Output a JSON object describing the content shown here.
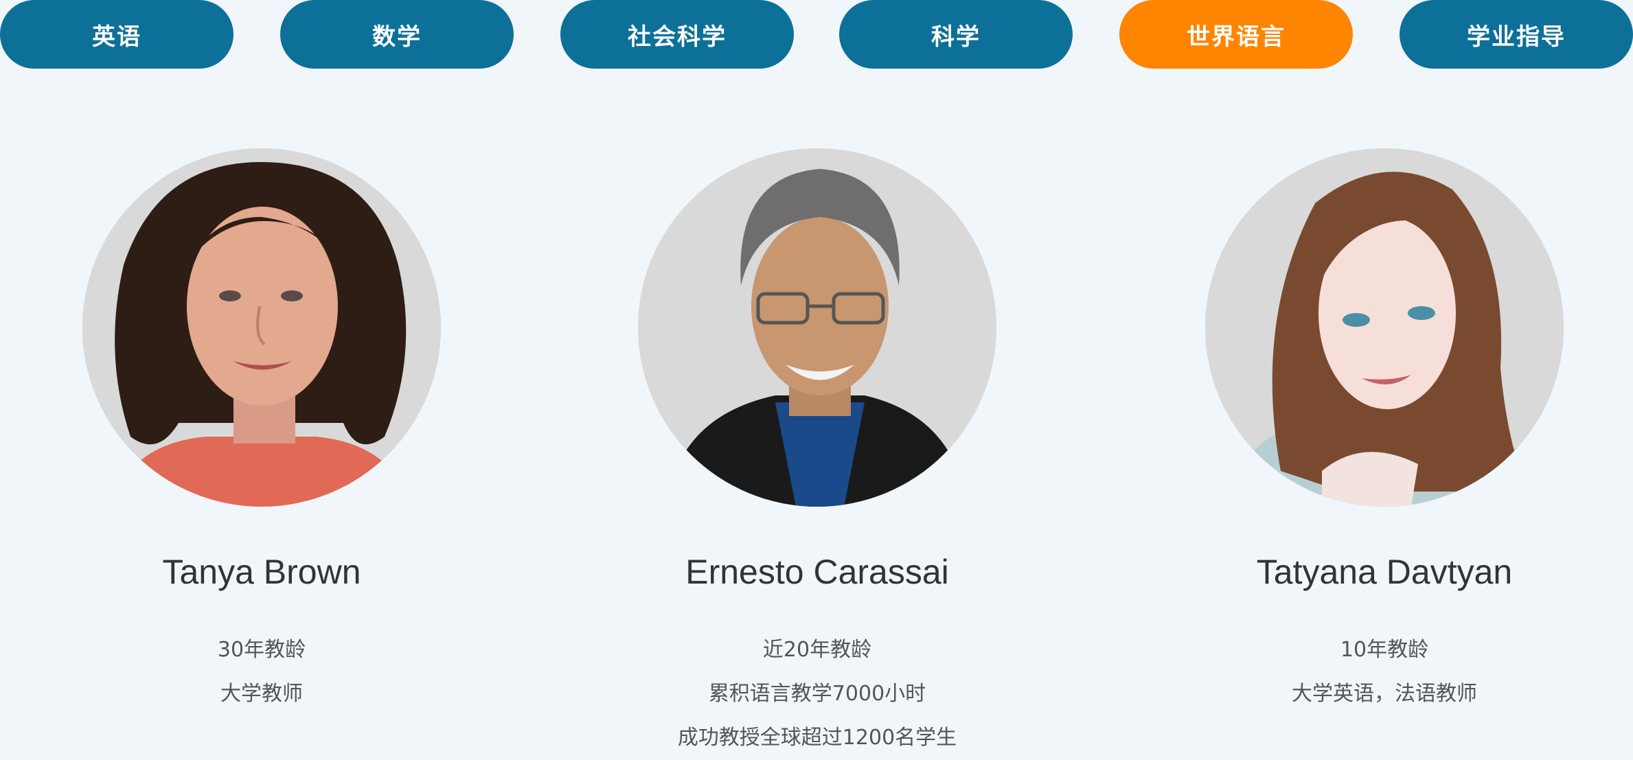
{
  "tabs": [
    {
      "label": "英语",
      "active": false
    },
    {
      "label": "数学",
      "active": false
    },
    {
      "label": "社会科学",
      "active": false
    },
    {
      "label": "科学",
      "active": false
    },
    {
      "label": "世界语言",
      "active": true
    },
    {
      "label": "学业指导",
      "active": false
    }
  ],
  "colors": {
    "tab": "#0d7098",
    "tab_active": "#ff8400",
    "background": "#f0f6fa",
    "name_text": "#333333",
    "detail_text": "#555555"
  },
  "teachers": [
    {
      "name": "Tanya Brown",
      "lines": [
        "30年教龄",
        "大学教师"
      ],
      "photo_icon": "woman-curly-hair-portrait"
    },
    {
      "name": "Ernesto Carassai",
      "lines": [
        "近20年教龄",
        "累积语言教学7000小时",
        "成功教授全球超过1200名学生"
      ],
      "photo_icon": "man-glasses-portrait"
    },
    {
      "name": "Tatyana Davtyan",
      "lines": [
        "10年教龄",
        "大学英语，法语教师"
      ],
      "photo_icon": "woman-long-hair-portrait"
    }
  ]
}
